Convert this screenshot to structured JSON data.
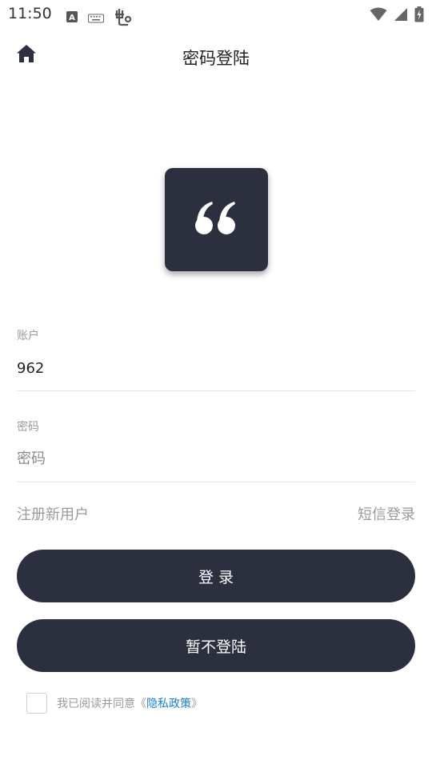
{
  "status_bar": {
    "time": "11:50",
    "left_icons": [
      "a-box-icon",
      "keyboard-icon",
      "app-bug-icon"
    ],
    "right_icons": [
      "wifi-icon",
      "signal-icon",
      "battery-charging-icon"
    ]
  },
  "nav": {
    "title": "密码登陆",
    "home_icon": "home-icon"
  },
  "logo": {
    "icon": "quote-mark-icon",
    "bg_color": "#2c2f3e"
  },
  "form": {
    "account": {
      "label": "账户",
      "value": "962"
    },
    "password": {
      "label": "密码",
      "placeholder": "密码"
    }
  },
  "links": {
    "register": "注册新用户",
    "sms_login": "短信登录"
  },
  "buttons": {
    "login": "登 录",
    "skip_login": "暂不登陆"
  },
  "agreement": {
    "prefix": "我已阅读并同意《",
    "link": "隐私政策",
    "suffix": "》",
    "link_color": "#1a7fd6"
  }
}
